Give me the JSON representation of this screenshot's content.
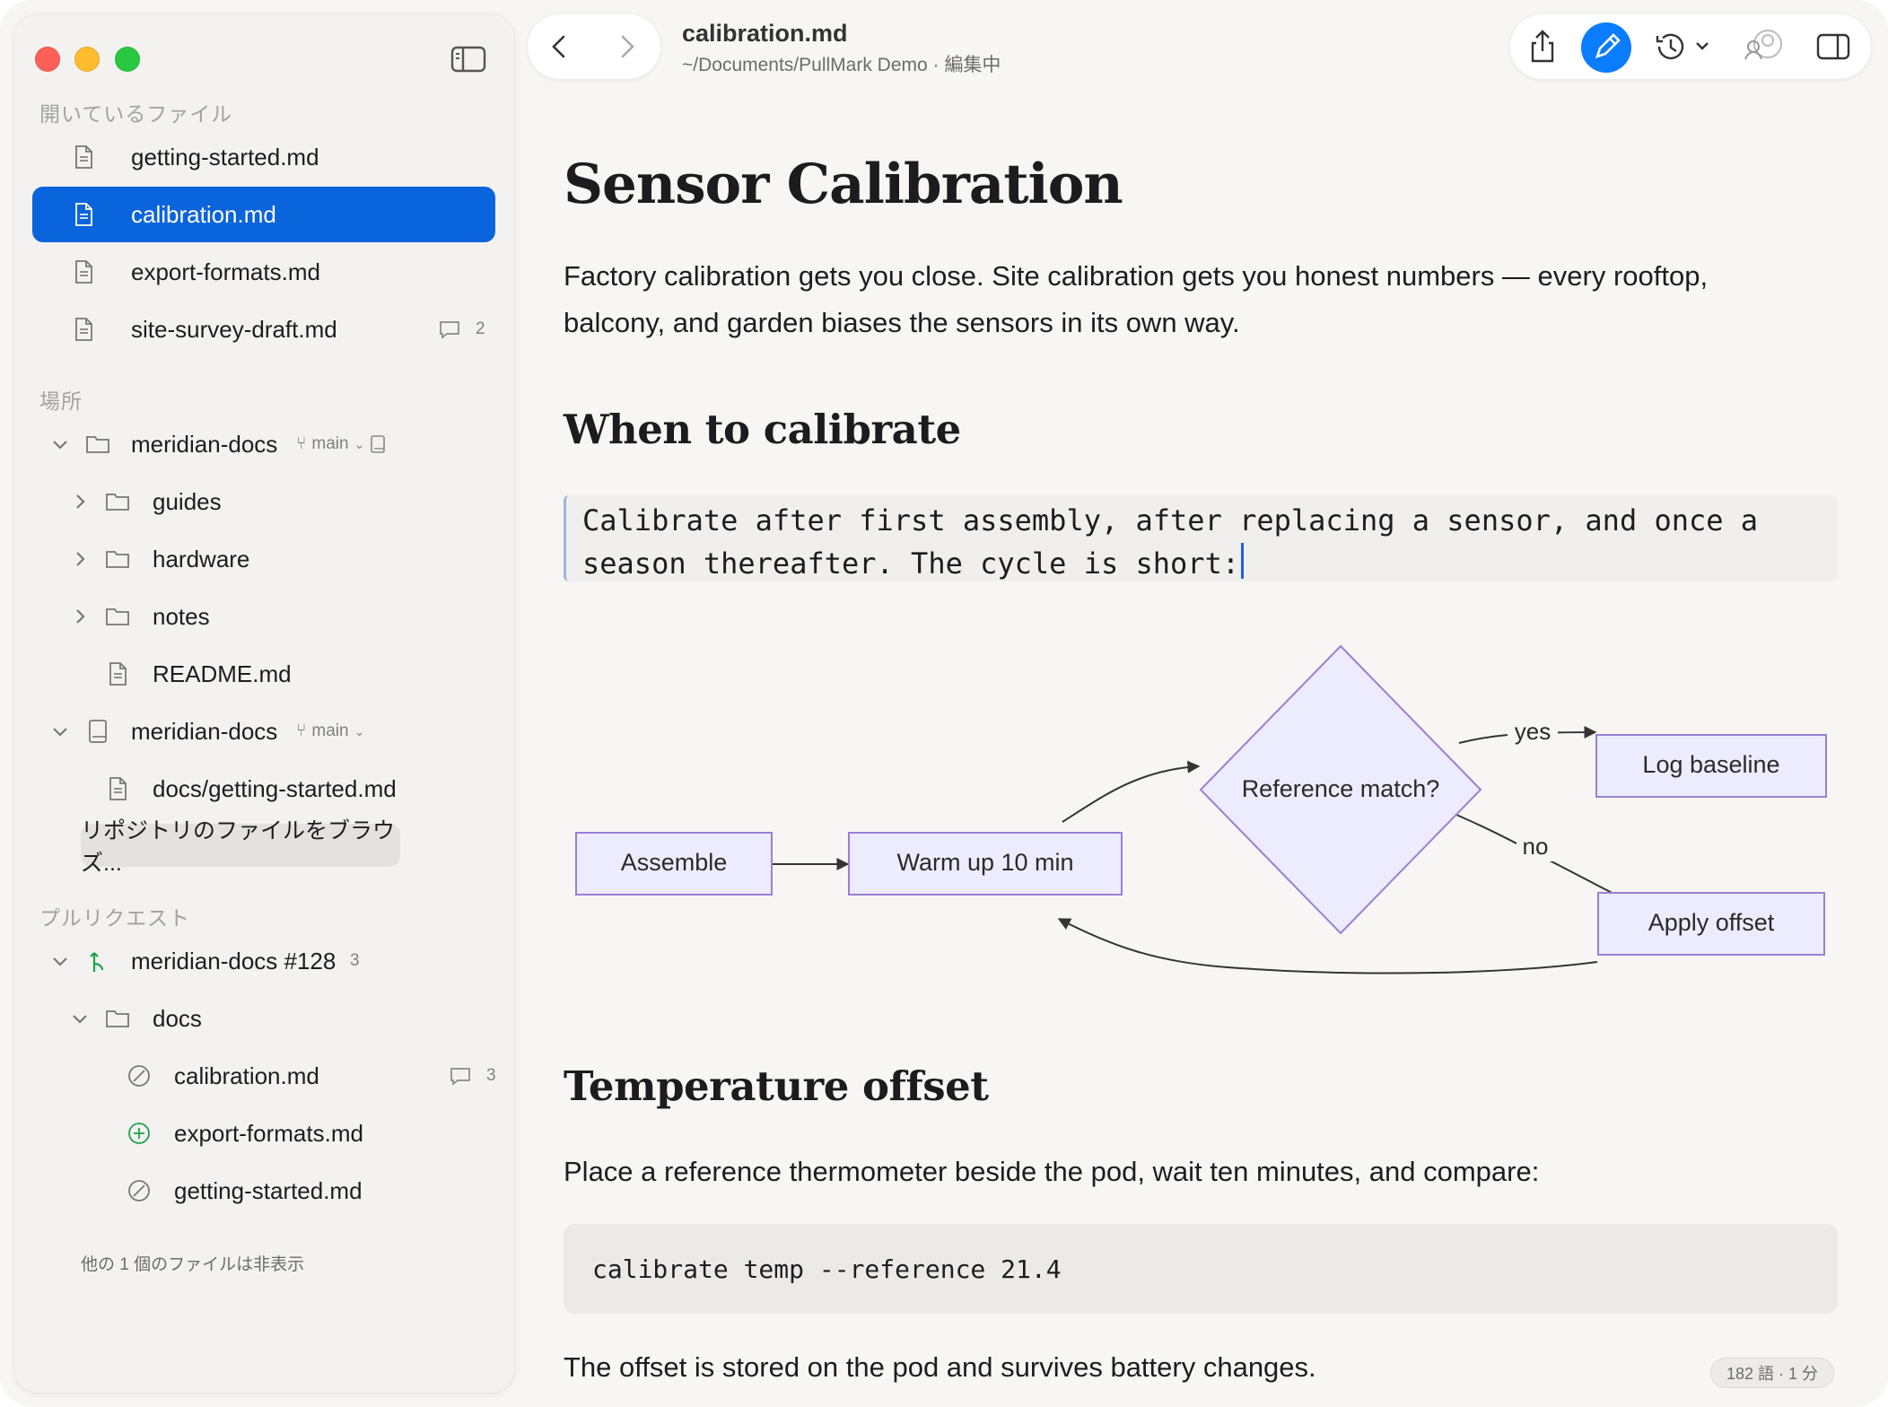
{
  "sidebar": {
    "open_files_header": "開いているファイル",
    "open_files": [
      {
        "label": "getting-started.md"
      },
      {
        "label": "calibration.md",
        "selected": true
      },
      {
        "label": "export-formats.md"
      },
      {
        "label": "site-survey-draft.md",
        "comments": "2"
      }
    ],
    "places_header": "場所",
    "repo1": {
      "label": "meridian-docs",
      "branch": "main"
    },
    "repo1_children": [
      {
        "label": "guides",
        "icon": "folder-icon"
      },
      {
        "label": "hardware",
        "icon": "folder-icon"
      },
      {
        "label": "notes",
        "icon": "folder-icon"
      },
      {
        "label": "README.md",
        "icon": "file-icon"
      }
    ],
    "repo2": {
      "label": "meridian-docs",
      "branch": "main"
    },
    "repo2_children": [
      {
        "label": "docs/getting-started.md"
      }
    ],
    "browse_button": "リポジトリのファイルをブラウズ...",
    "pr_header": "プルリクエスト",
    "pr": {
      "label": "meridian-docs #128",
      "count": "3"
    },
    "pr_folder": "docs",
    "pr_files": [
      {
        "label": "calibration.md",
        "status": "modified",
        "comments": "3"
      },
      {
        "label": "export-formats.md",
        "status": "added"
      },
      {
        "label": "getting-started.md",
        "status": "modified"
      }
    ],
    "hidden_note": "他の 1 個のファイルは非表示"
  },
  "toolbar": {
    "title": "calibration.md",
    "path": "~/Documents/PullMark Demo · 編集中",
    "icons": [
      "back-icon",
      "forward-icon",
      "share-icon",
      "edit-icon",
      "history-icon",
      "collaborators-icon",
      "inspector-icon"
    ],
    "accent": "#0a7cff"
  },
  "document": {
    "h1": "Sensor Calibration",
    "intro_line1": "Factory calibration gets you close. Site calibration gets you honest numbers — every rooftop,",
    "intro_line2": "balcony, and garden biases the sensors in its own way.",
    "h2_when": "When to calibrate",
    "quote_line1": "Calibrate after first assembly, after replacing a sensor, and once a",
    "quote_line2": "season thereafter. The cycle is short:",
    "flow": {
      "nodes": {
        "assemble": "Assemble",
        "warmup": "Warm up 10 min",
        "reference": "Reference match?",
        "log": "Log baseline",
        "apply": "Apply offset"
      },
      "edge_labels": {
        "yes": "yes",
        "no": "no"
      }
    },
    "h2_temp": "Temperature offset",
    "temp_text": "Place a reference thermometer beside the pod, wait ten minutes, and compare:",
    "code": "calibrate temp --reference 21.4",
    "closing": "The offset is stored on the pod and survives battery changes."
  },
  "status": {
    "wordcount": "182 語 · 1 分"
  }
}
